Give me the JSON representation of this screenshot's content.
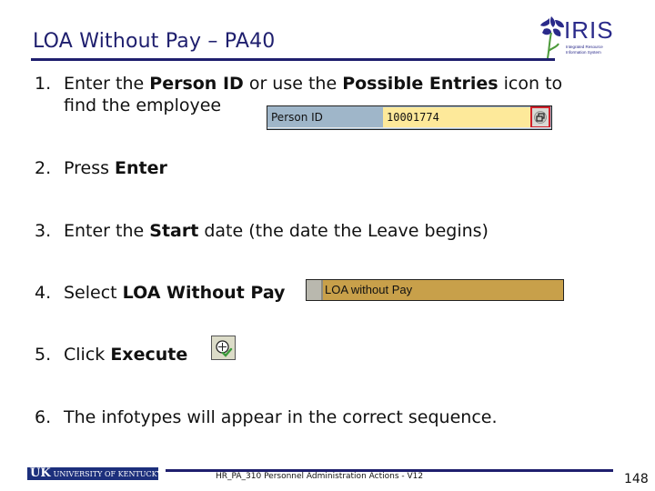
{
  "slide": {
    "title": "LOA Without Pay – PA40",
    "logo": {
      "word": "IRIS",
      "tagline_line1": "Integrated Resource",
      "tagline_line2": "Information System"
    },
    "steps": [
      {
        "num": "1.",
        "pre": "Enter the ",
        "b1": "Person ID",
        "mid": " or use the ",
        "b2": "Possible Entries",
        "post": " icon to",
        "cont": "find the employee"
      },
      {
        "num": "2.",
        "pre": "Press ",
        "b1": "Enter"
      },
      {
        "num": "3.",
        "pre": "Enter the ",
        "b1": "Start",
        "post": " date (the date the Leave begins)"
      },
      {
        "num": "4.",
        "pre": "Select ",
        "b1": "LOA Without Pay"
      },
      {
        "num": "5.",
        "pre": "Click ",
        "b1": "Execute"
      },
      {
        "num": "6.",
        "pre": "The infotypes will appear in the correct sequence."
      }
    ],
    "person_id_field": {
      "label": "Person ID",
      "value": "10001774",
      "possible_entries_icon": "possible-entries-icon"
    },
    "action_row": {
      "label": "LOA without Pay"
    },
    "execute_icon": "execute-icon",
    "footer": {
      "uk_abbrev": "UK",
      "university": "UNIVERSITY OF KENTUCKY",
      "course_text": "HR_PA_310 Personnel Administration Actions - V12",
      "page_number": "148"
    },
    "colors": {
      "title": "#1f1f6e",
      "field_label_bg": "#9fb6c9",
      "field_input_bg": "#fde99a",
      "highlight_border": "#d0202a",
      "action_row_bg": "#c8a04a",
      "uk_blue": "#1c2f7c"
    }
  }
}
